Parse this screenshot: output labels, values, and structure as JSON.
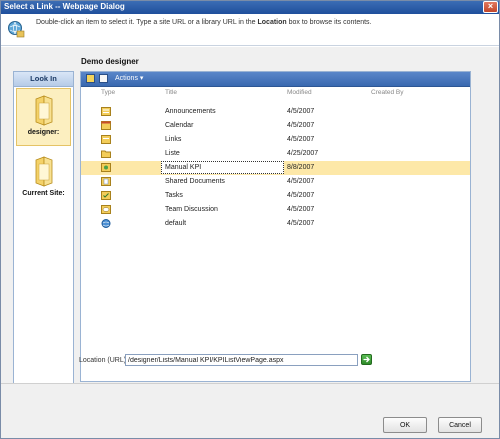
{
  "window": {
    "title": "Select a Link -- Webpage Dialog",
    "close_glyph": "×"
  },
  "instructions": {
    "part1": "Double-click an item to select it. Type a site URL or a library URL in the ",
    "bold": "Location",
    "part2": " box to browse its contents."
  },
  "look_in": {
    "header": "Look In",
    "items": [
      {
        "label": "designer:",
        "selected": true
      },
      {
        "label": "Current Site:",
        "selected": false
      }
    ]
  },
  "main": {
    "title": "Demo designer",
    "toolbar": {
      "actions_label": "Actions",
      "actions_arrow": "▾"
    },
    "columns": {
      "type": "Type",
      "title": "Title",
      "modified": "Modified",
      "created_by": "Created By"
    },
    "rows": [
      {
        "icon": "list-icon",
        "title": "Announcements",
        "modified": "4/5/2007",
        "selected": false
      },
      {
        "icon": "calendar-icon",
        "title": "Calendar",
        "modified": "4/5/2007",
        "selected": false
      },
      {
        "icon": "list-icon",
        "title": "Links",
        "modified": "4/5/2007",
        "selected": false
      },
      {
        "icon": "folder-icon",
        "title": "Liste",
        "modified": "4/25/2007",
        "selected": false
      },
      {
        "icon": "kpi-list-icon",
        "title": "Manual KPI",
        "modified": "8/8/2007",
        "selected": true
      },
      {
        "icon": "document-library-icon",
        "title": "Shared Documents",
        "modified": "4/5/2007",
        "selected": false
      },
      {
        "icon": "tasks-icon",
        "title": "Tasks",
        "modified": "4/5/2007",
        "selected": false
      },
      {
        "icon": "discussion-icon",
        "title": "Team Discussion",
        "modified": "4/5/2007",
        "selected": false
      },
      {
        "icon": "page-icon",
        "title": "default",
        "modified": "4/5/2007",
        "selected": false
      }
    ]
  },
  "location": {
    "label": "Location (URL):",
    "value": "/designer/Lists/Manual KPI/KPIListViewPage.aspx"
  },
  "buttons": {
    "ok": "OK",
    "cancel": "Cancel"
  },
  "colors": {
    "accent": "#3969b0",
    "selected_row": "#fde8a8",
    "title_bar": "#2c5ca6"
  }
}
